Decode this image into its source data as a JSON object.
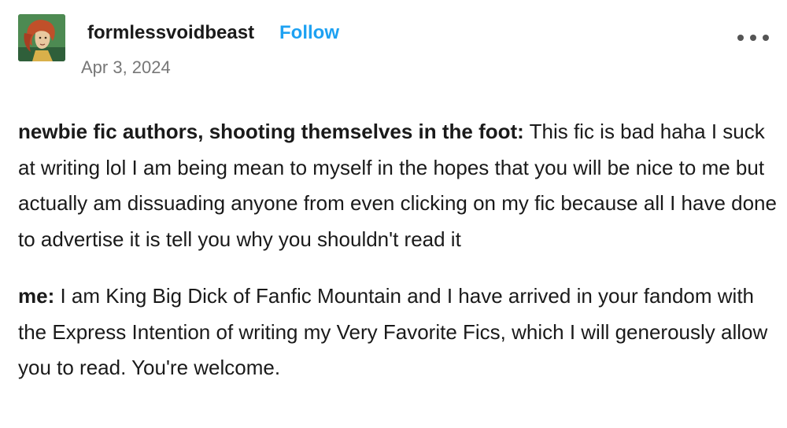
{
  "post": {
    "blog_name": "formlessvoidbeast",
    "follow_label": "Follow",
    "date": "Apr 3, 2024",
    "more_icon": "more-horizontal-icon",
    "paragraphs": [
      {
        "speaker": "newbie fic authors, shooting themselves in the foot:",
        "text": " This fic is bad haha I suck at writing lol I am being mean to myself in the hopes that you will be nice to me but actually am dissuading anyone from even clicking on my fic because all I have done to advertise it is tell you why you shouldn't read it"
      },
      {
        "speaker": "me:",
        "text": " I am King Big Dick of Fanfic Mountain and I have arrived in your fandom with the Express Intention of writing my Very Favorite Fics, which I will generously allow you to read. You're welcome."
      }
    ]
  },
  "colors": {
    "follow": "#1da1f2",
    "date": "#777777",
    "text": "#1a1a1a",
    "avatar_bg": "#4d8a52"
  }
}
